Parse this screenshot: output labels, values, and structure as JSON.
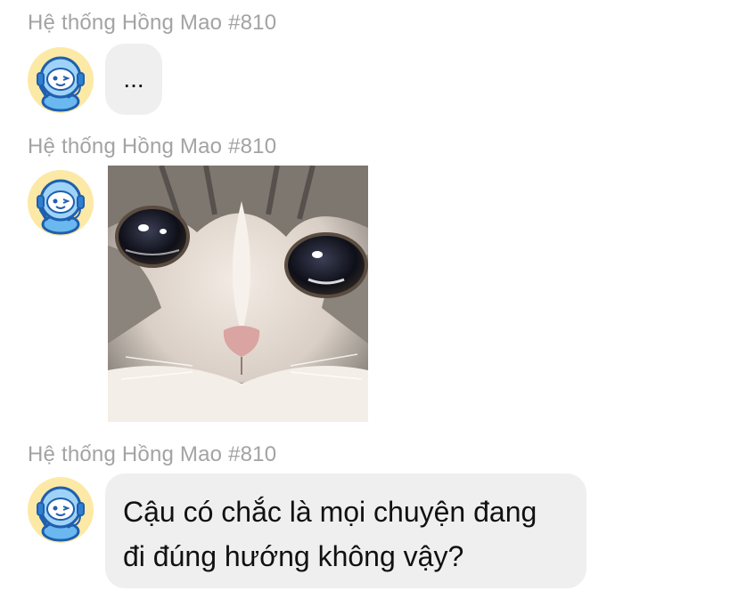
{
  "messages": [
    {
      "sender": "Hệ thống Hồng Mao #810",
      "type": "text",
      "text": "..."
    },
    {
      "sender": "Hệ thống Hồng Mao #810",
      "type": "image",
      "image_subject": "crying-cat-photo"
    },
    {
      "sender": "Hệ thống Hồng Mao #810",
      "type": "text",
      "text_lines": [
        "Cậu có chắc là mọi chuyện đang",
        "đi đúng hướng không vậy?"
      ]
    }
  ],
  "avatar": {
    "icon": "robot-headset-avatar-icon",
    "colors": {
      "body": "#6bb8f0",
      "outline": "#1f5fae",
      "accent": "#f6c744"
    }
  }
}
